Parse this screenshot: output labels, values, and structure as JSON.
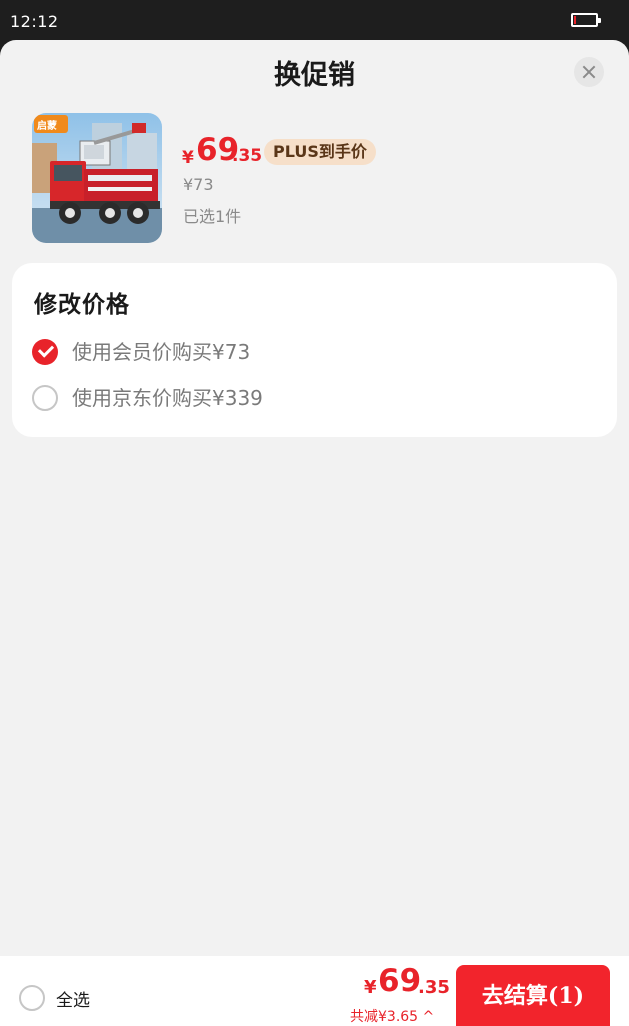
{
  "status_bar": {
    "time": "12:12",
    "battery_level": 0.1,
    "battery_color": "#e8232a"
  },
  "sheet": {
    "title": "换促销"
  },
  "product": {
    "price_yen": "¥",
    "price_int": "69",
    "price_dec": ".35",
    "plus_badge": "PLUS到手价",
    "original_price": "¥73",
    "selected_count": "已选1件",
    "thumbnail_brand": "启蒙"
  },
  "price_options": {
    "title": "修改价格",
    "options": [
      {
        "label": "使用会员价购买¥73",
        "checked": true
      },
      {
        "label": "使用京东价购买¥339",
        "checked": false
      }
    ]
  },
  "bottom_bar": {
    "select_all_label": "全选",
    "total_yen": "¥",
    "total_int": "69",
    "total_dec": ".35",
    "discount": "共减¥3.65 ^",
    "checkout_label": "去结算(1)"
  },
  "colors": {
    "accent": "#e8232a",
    "plus_badge_bg": "#f6dfc9",
    "sheet_bg": "#f2f2f2"
  }
}
